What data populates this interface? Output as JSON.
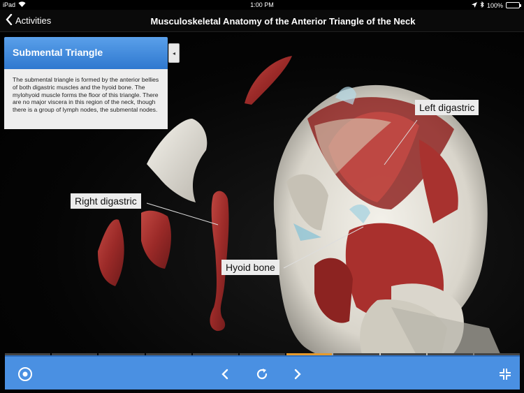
{
  "status_bar": {
    "device": "iPad",
    "time": "1:00 PM",
    "battery": "100%",
    "battery_level": 1.0
  },
  "nav": {
    "back_label": "Activities",
    "title": "Musculoskeletal Anatomy of the Anterior Triangle of the Neck"
  },
  "info_panel": {
    "title": "Submental Triangle",
    "body": "The submental triangle is formed by the anterior bellies of both digastric muscles and the hyoid bone. The mylohyoid muscle forms the floor of this triangle. There are no major viscera in this region of the neck, though there is a group of lymph nodes, the submental nodes.",
    "toggle_icon": "◂"
  },
  "labels": {
    "left_digastric": "Left digastric",
    "right_digastric": "Right digastric",
    "hyoid_bone": "Hyoid bone"
  },
  "toolbar": {
    "record_icon": "◉",
    "prev_icon": "‹",
    "reset_icon": "↻",
    "next_icon": "›",
    "collapse_icon": "⇲"
  },
  "timeline": {
    "segments": 11,
    "active_segment": 7
  },
  "colors": {
    "accent": "#4a90e2",
    "panel_header": "#3b83d8",
    "timeline_active": "#e59a2d",
    "muscle": "#a3302e",
    "bone": "#e6e3da"
  }
}
